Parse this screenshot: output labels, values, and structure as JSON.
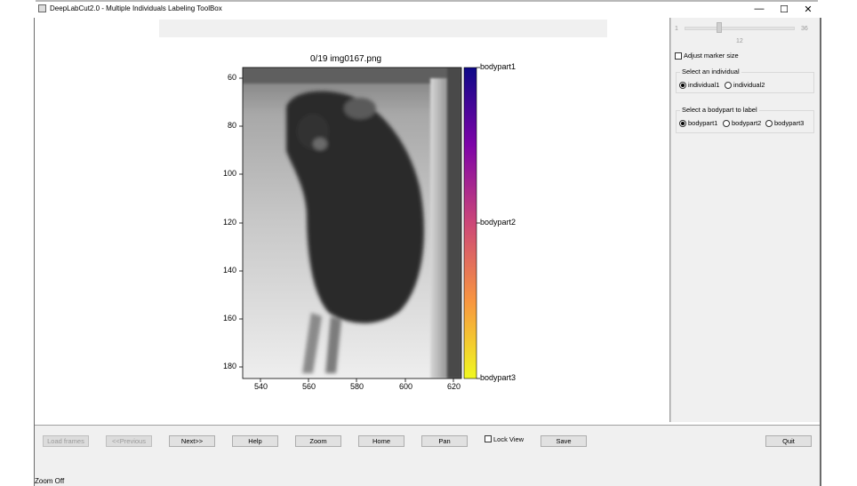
{
  "window": {
    "title": "DeepLabCut2.0 - Multiple Individuals Labeling ToolBox",
    "minimize": "—",
    "maximize": "☐",
    "close": "✕"
  },
  "plot": {
    "title": "0/19 img0167.png",
    "y_ticks": [
      "60",
      "80",
      "100",
      "120",
      "140",
      "160",
      "180"
    ],
    "x_ticks": [
      "540",
      "560",
      "580",
      "600",
      "620"
    ],
    "colorbar_labels": [
      "bodypart1",
      "bodypart2",
      "bodypart3"
    ]
  },
  "right_panel": {
    "slider": {
      "min": "1",
      "max": "36",
      "value": "12"
    },
    "adjust_marker_label": "Adjust marker size",
    "individual_group": {
      "title": "Select an individual",
      "options": [
        "individual1",
        "individual2"
      ],
      "selected": "individual1"
    },
    "bodypart_group": {
      "title": "Select a bodypart to label",
      "options": [
        "bodypart1",
        "bodypart2",
        "bodypart3"
      ],
      "selected": "bodypart1"
    }
  },
  "bottom": {
    "load_frames": "Load frames",
    "previous": "<<Previous",
    "next": "Next>>",
    "help": "Help",
    "zoom": "Zoom",
    "home": "Home",
    "pan": "Pan",
    "lock_view": "Lock View",
    "save": "Save",
    "quit": "Quit"
  },
  "status": {
    "text": "Zoom Off"
  },
  "colors": {
    "colormap": [
      "#0d0887",
      "#7e03a8",
      "#cc4778",
      "#f89540",
      "#f0f921"
    ],
    "panel_bg": "#f0f0f0"
  }
}
